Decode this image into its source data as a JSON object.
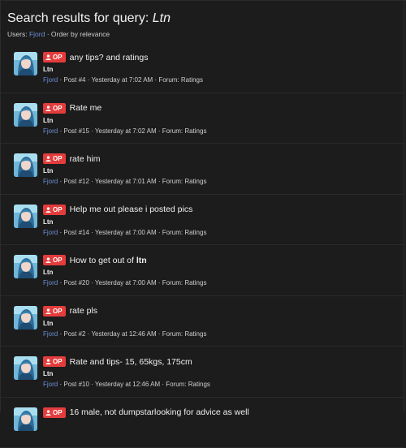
{
  "header": {
    "title_prefix": "Search results for query:",
    "query": "Ltn",
    "users_label": "Users:",
    "user": "Fjord",
    "order": "· Order by relevance"
  },
  "colors": {
    "background": "#1c1c1c",
    "op_badge": "#e33c3c",
    "link": "#6d8fd6"
  },
  "op_label": "OP",
  "results": [
    {
      "title_pre": "any tips? and ratings",
      "title_bold": "",
      "snippet": "Ltn",
      "author": "Fjord",
      "info": "· Post #4 · Yesterday at 7:02 AM · Forum: Ratings"
    },
    {
      "title_pre": "Rate me",
      "title_bold": "",
      "snippet": "Ltn",
      "author": "Fjord",
      "info": "· Post #15 · Yesterday at 7:02 AM · Forum: Ratings"
    },
    {
      "title_pre": "rate him",
      "title_bold": "",
      "snippet": "Ltn",
      "author": "Fjord",
      "info": "· Post #12 · Yesterday at 7:01 AM · Forum: Ratings"
    },
    {
      "title_pre": "Help me out please i posted pics",
      "title_bold": "",
      "snippet": "Ltn",
      "author": "Fjord",
      "info": "· Post #14 · Yesterday at 7:00 AM · Forum: Ratings"
    },
    {
      "title_pre": "How to get out of ",
      "title_bold": "ltn",
      "snippet": "Ltn",
      "author": "Fjord",
      "info": "· Post #20 · Yesterday at 7:00 AM · Forum: Ratings"
    },
    {
      "title_pre": "rate pls",
      "title_bold": "",
      "snippet": "Ltn",
      "author": "Fjord",
      "info": "· Post #2 · Yesterday at 12:46 AM · Forum: Ratings"
    },
    {
      "title_pre": "Rate and tips- 15, 65kgs, 175cm",
      "title_bold": "",
      "snippet": "Ltn",
      "author": "Fjord",
      "info": "· Post #10 · Yesterday at 12:46 AM · Forum: Ratings"
    },
    {
      "title_pre": "16 male, not dumpstarlooking for advice as well",
      "title_bold": "",
      "snippet": "",
      "author": "",
      "info": ""
    }
  ]
}
